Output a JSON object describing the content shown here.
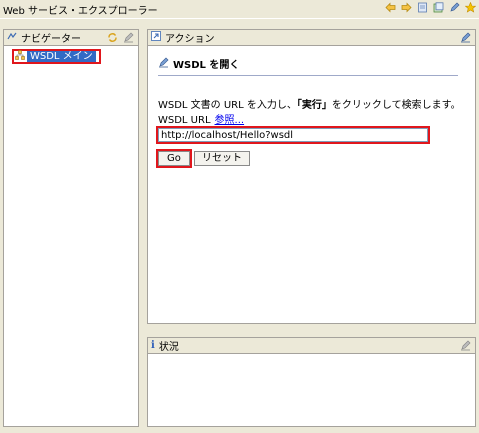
{
  "window": {
    "title": "Web サービス・エクスプローラー",
    "toolbar_icons": [
      "back-arrow-icon",
      "forward-arrow-icon",
      "page-icon",
      "document-icon",
      "edit-icon",
      "favorites-star-icon"
    ]
  },
  "navigator": {
    "title": "ナビゲーター",
    "tree": [
      {
        "label": "WSDL メイン",
        "selected": true
      }
    ]
  },
  "actions": {
    "title": "アクション",
    "section_title": "WSDL を開く",
    "description_before": "WSDL 文書の URL を入力し、",
    "description_bold": "「実行」",
    "description_after": "をクリックして検索します。",
    "url_label": "WSDL URL",
    "browse_link": "参照...",
    "url_value": "http://localhost/Hello?wsdl",
    "go_label": "Go",
    "reset_label": "リセット"
  },
  "status": {
    "title": "状況"
  },
  "colors": {
    "background": "#ece9d8",
    "selection": "#316ac5",
    "highlight_border": "#e0161c",
    "link": "#0000ee"
  }
}
